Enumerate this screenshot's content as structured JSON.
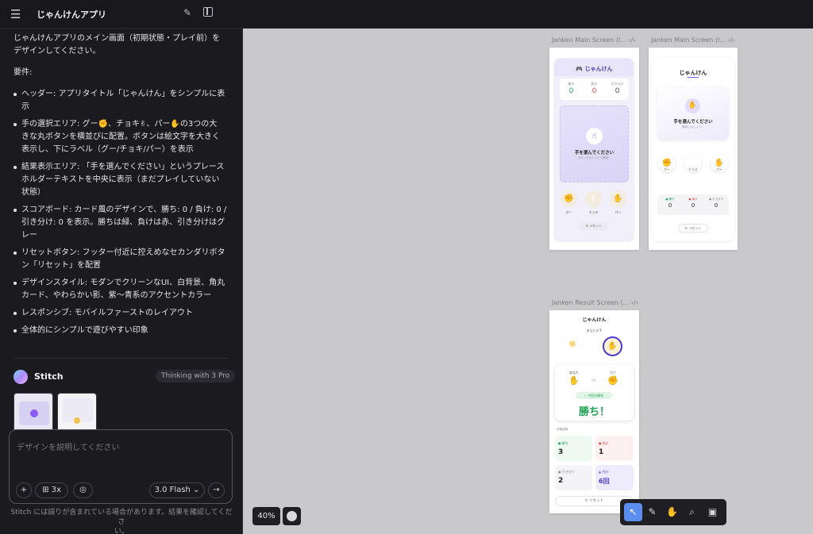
{
  "app": {
    "title": "じゃんけんアプリ"
  },
  "prompt": {
    "intro_1": "じゃんけんアプリのメイン画面（初期状態・プレイ前）を",
    "intro_2": "デザインしてください。",
    "req_heading": "要件:",
    "items": [
      {
        "l1": "ヘッダー: アプリタイトル「じゃんけん」をシンプルに表",
        "l2": "示"
      },
      {
        "l1": "手の選択エリア: グー✊、チョキ✌、パー✋の3つの大",
        "l2": "きな丸ボタンを横並びに配置。ボタンは絵文字を大きく",
        "l3": "表示し、下にラベル（グー/チョキ/パー）を表示"
      },
      {
        "l1": "結果表示エリア: 「手を選んでください」というプレース",
        "l2": "ホルダーテキストを中央に表示（まだプレイしていない",
        "l3": "状態）"
      },
      {
        "l1": "スコアボード: カード風のデザインで、勝ち: 0 / 負け: 0 /",
        "l2": "引き分け: 0 を表示。勝ちは緑、負けは赤、引き分けはグ",
        "l3": "レー"
      },
      {
        "l1": "リセットボタン: フッター付近に控えめなセカンダリボタ",
        "l2": "ン「リセット」を配置"
      },
      {
        "l1": "デザインスタイル: モダンでクリーンなUI、白背景、角丸",
        "l2": "カード、やわらかい影、紫〜青系のアクセントカラー"
      },
      {
        "l1": "レスポンシブ: モバイルファーストのレイアウト"
      },
      {
        "l1": "全体的にシンプルで遊びやすい印象"
      }
    ]
  },
  "assistant": {
    "name": "Stitch",
    "thinking": "Thinking with 3 Pro"
  },
  "composer": {
    "placeholder": "デザインを説明してください",
    "variants": "3x",
    "model": "3.0 Flash"
  },
  "footer": {
    "line1": "Stitch には誤りが含まれている場合があります。結果を確認してくださ",
    "line2": "い。"
  },
  "canvas": {
    "frame1_label": "Janken Main Screen (I...",
    "frame2_label": "Janken Main Screen (I...",
    "frame3_label": "Janken Result Screen (...",
    "zoom": "40%"
  },
  "screen1": {
    "title": "じゃんけん",
    "score_labels": [
      "勝ち",
      "負け",
      "引き分け"
    ],
    "scores": [
      "0",
      "0",
      "0"
    ],
    "placeholder": "手を選んでください",
    "sub": "ボタンをタップして開始！",
    "hands": [
      "グー",
      "チョキ",
      "パー"
    ],
    "reset": "リセット"
  },
  "screen2": {
    "title": "じゃんけん",
    "placeholder": "手を選んでください",
    "sub": "勝負しましょう！",
    "hands": [
      "グー",
      "チョキ",
      "パー"
    ],
    "score_labels": [
      "勝ち",
      "負け",
      "引き分け"
    ],
    "scores": [
      "0",
      "0",
      "0"
    ],
    "reset": "リセット"
  },
  "screen3": {
    "title": "じゃんけん",
    "your_choice": "あなたの手",
    "you": "あなた",
    "cpu": "相手",
    "vs": "VS",
    "badge": "今回の勝利",
    "result": "勝ち！",
    "stats_title": "対戦成績",
    "stats": [
      {
        "label": "勝ち",
        "value": "3"
      },
      {
        "label": "負け",
        "value": "1"
      },
      {
        "label": "引き分け",
        "value": "2"
      },
      {
        "label": "合計",
        "value": "6回"
      }
    ],
    "reset": "リセット"
  },
  "colors": {
    "accent": "#7c5cf0",
    "win": "#22a355",
    "lose": "#e04848",
    "draw": "#8a8a92"
  }
}
